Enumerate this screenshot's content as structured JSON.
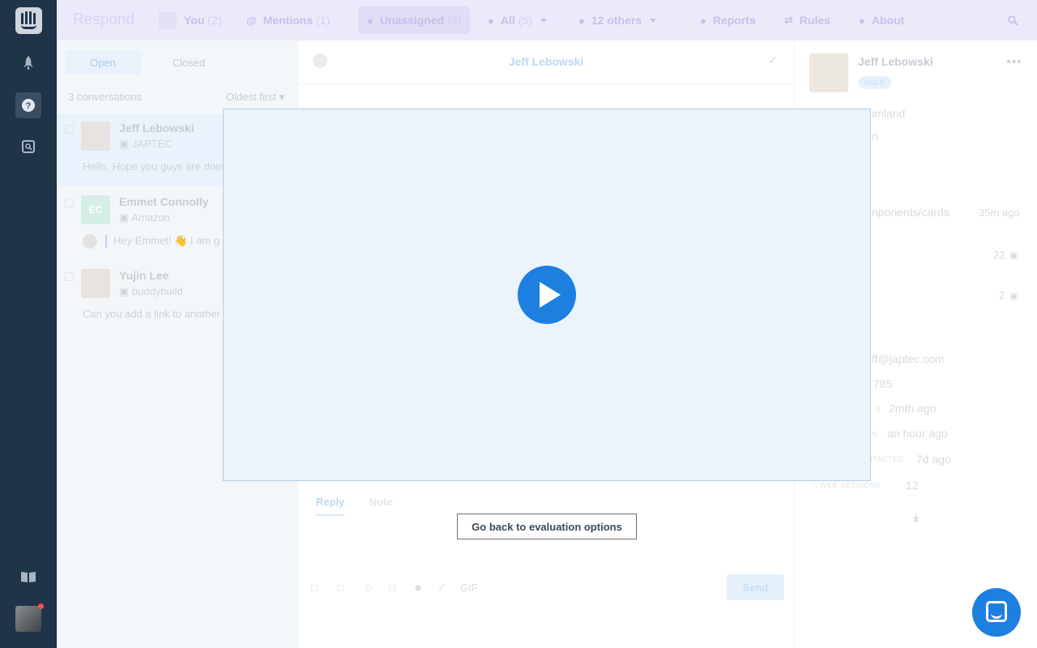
{
  "app": {
    "title": "Respond"
  },
  "topbar": {
    "you": {
      "label": "You",
      "count": "(2)"
    },
    "mentions": {
      "label": "Mentions",
      "count": "(1)"
    },
    "unassigned": {
      "label": "Unassigned",
      "count": "(3)"
    },
    "all": {
      "label": "All",
      "count": "(5)"
    },
    "others": {
      "label": "12 others"
    },
    "reports": {
      "label": "Reports"
    },
    "rules": {
      "label": "Rules"
    },
    "about": {
      "label": "About"
    }
  },
  "rail": {
    "icons": [
      "intercom-logo-icon",
      "rocket-icon",
      "help-icon",
      "search-doc-icon",
      "book-icon"
    ],
    "colors": {
      "background": "#1f3349",
      "notification": "#ff4b4b"
    }
  },
  "list": {
    "tabs": [
      {
        "label": "Open"
      },
      {
        "label": "Closed"
      }
    ],
    "count_label": "3 conversations",
    "sort_label": "Oldest first",
    "conversations": [
      {
        "name": "Jeff Lebowski",
        "company": "JAPTEC",
        "preview": "Hello, Hope you guys are doin"
      },
      {
        "name": "Emmet Connolly",
        "initials": "EC",
        "company": "Amazon",
        "preview": "Hey Emmet! 👋 I am g"
      },
      {
        "name": "Yujin Lee",
        "company": "buddybuild",
        "preview": "Can you add a link to another"
      }
    ]
  },
  "conversation": {
    "title": "Jeff Lebowski",
    "reply_tabs": [
      {
        "label": "Reply"
      },
      {
        "label": "Note"
      }
    ],
    "toolbar_gif": "GIF",
    "send_label": "Send"
  },
  "details": {
    "name": "Jeff Lebowski",
    "badge": "USER",
    "more": "•••",
    "lines": [
      "imland",
      "n",
      "nponents/cards",
      "35m ago",
      "22",
      "2",
      "ff@japtec.com",
      "785",
      "2mth ago",
      "an hour ago",
      "7d ago",
      "12"
    ],
    "labels": [
      "N",
      "N",
      "NTACTED",
      "WEB SESSIONS"
    ]
  },
  "video": {
    "goback_label": "Go back to evaluation options"
  },
  "colors": {
    "accent": "#1d7fe0",
    "topbar": "#ece9fb",
    "video_bg": "#ebf3fb"
  }
}
